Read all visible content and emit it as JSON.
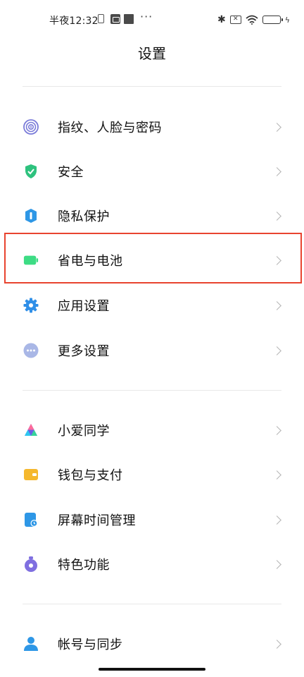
{
  "status_bar": {
    "time": "半夜12:32",
    "more_glyph": "···",
    "bluetooth_glyph": "✱",
    "x_glyph": "✕",
    "bolt_glyph": "ϟ"
  },
  "page_title": "设置",
  "sections": [
    {
      "items": [
        {
          "label": "指纹、人脸与密码",
          "icon": "fingerprint-icon",
          "color": "#7b7cd9"
        },
        {
          "label": "安全",
          "icon": "shield-icon",
          "color": "#2ec27e"
        },
        {
          "label": "隐私保护",
          "icon": "privacy-icon",
          "color": "#2e97e6"
        },
        {
          "label": "省电与电池",
          "icon": "battery-icon",
          "color": "#3ddc84"
        },
        {
          "label": "应用设置",
          "icon": "gear-icon",
          "color": "#2f8fe8"
        },
        {
          "label": "更多设置",
          "icon": "more-dots-icon",
          "color": "#a9b7e6"
        }
      ]
    },
    {
      "items": [
        {
          "label": "小爱同学",
          "icon": "xiaoai-icon",
          "color": "#6c5ce7"
        },
        {
          "label": "钱包与支付",
          "icon": "wallet-icon",
          "color": "#f5b82e"
        },
        {
          "label": "屏幕时间管理",
          "icon": "screen-time-icon",
          "color": "#2e97e6"
        },
        {
          "label": "特色功能",
          "icon": "special-features-icon",
          "color": "#7f6fe0"
        }
      ]
    },
    {
      "items": [
        {
          "label": "帐号与同步",
          "icon": "account-icon",
          "color": "#2e97e6"
        }
      ]
    }
  ]
}
